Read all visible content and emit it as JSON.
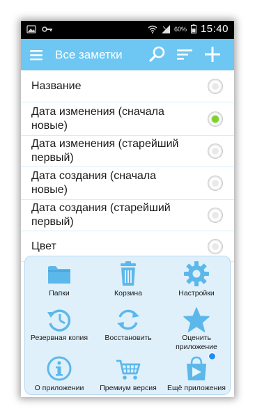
{
  "status_bar": {
    "battery_percent": "60%",
    "time": "15:40"
  },
  "app_bar": {
    "title": "Все заметки"
  },
  "sort_options": [
    {
      "label": "Название",
      "selected": false
    },
    {
      "label": "Дата изменения (сначала новые)",
      "selected": true
    },
    {
      "label": "Дата изменения (старейший первый)",
      "selected": false
    },
    {
      "label": "Дата создания (сначала новые)",
      "selected": false
    },
    {
      "label": "Дата создания (старейший первый)",
      "selected": false
    },
    {
      "label": "Цвет",
      "selected": false
    }
  ],
  "panel": {
    "items": [
      {
        "label": "Папки",
        "icon": "folder-icon"
      },
      {
        "label": "Корзина",
        "icon": "trash-icon"
      },
      {
        "label": "Настройки",
        "icon": "gear-icon"
      },
      {
        "label": "Резервная копия",
        "icon": "backup-history-icon"
      },
      {
        "label": "Восстановить",
        "icon": "restore-icon"
      },
      {
        "label": "Оценить приложение",
        "icon": "star-icon"
      },
      {
        "label": "О приложении",
        "icon": "info-icon"
      },
      {
        "label": "Премиум версия",
        "icon": "cart-icon"
      },
      {
        "label": "Ещё приложения",
        "icon": "store-bag-icon"
      }
    ]
  },
  "colors": {
    "accent": "#6ec6f2",
    "icon_blue": "#5cb8ea",
    "panel_bg": "#dff0fb",
    "radio_selected": "#7fd22a"
  }
}
